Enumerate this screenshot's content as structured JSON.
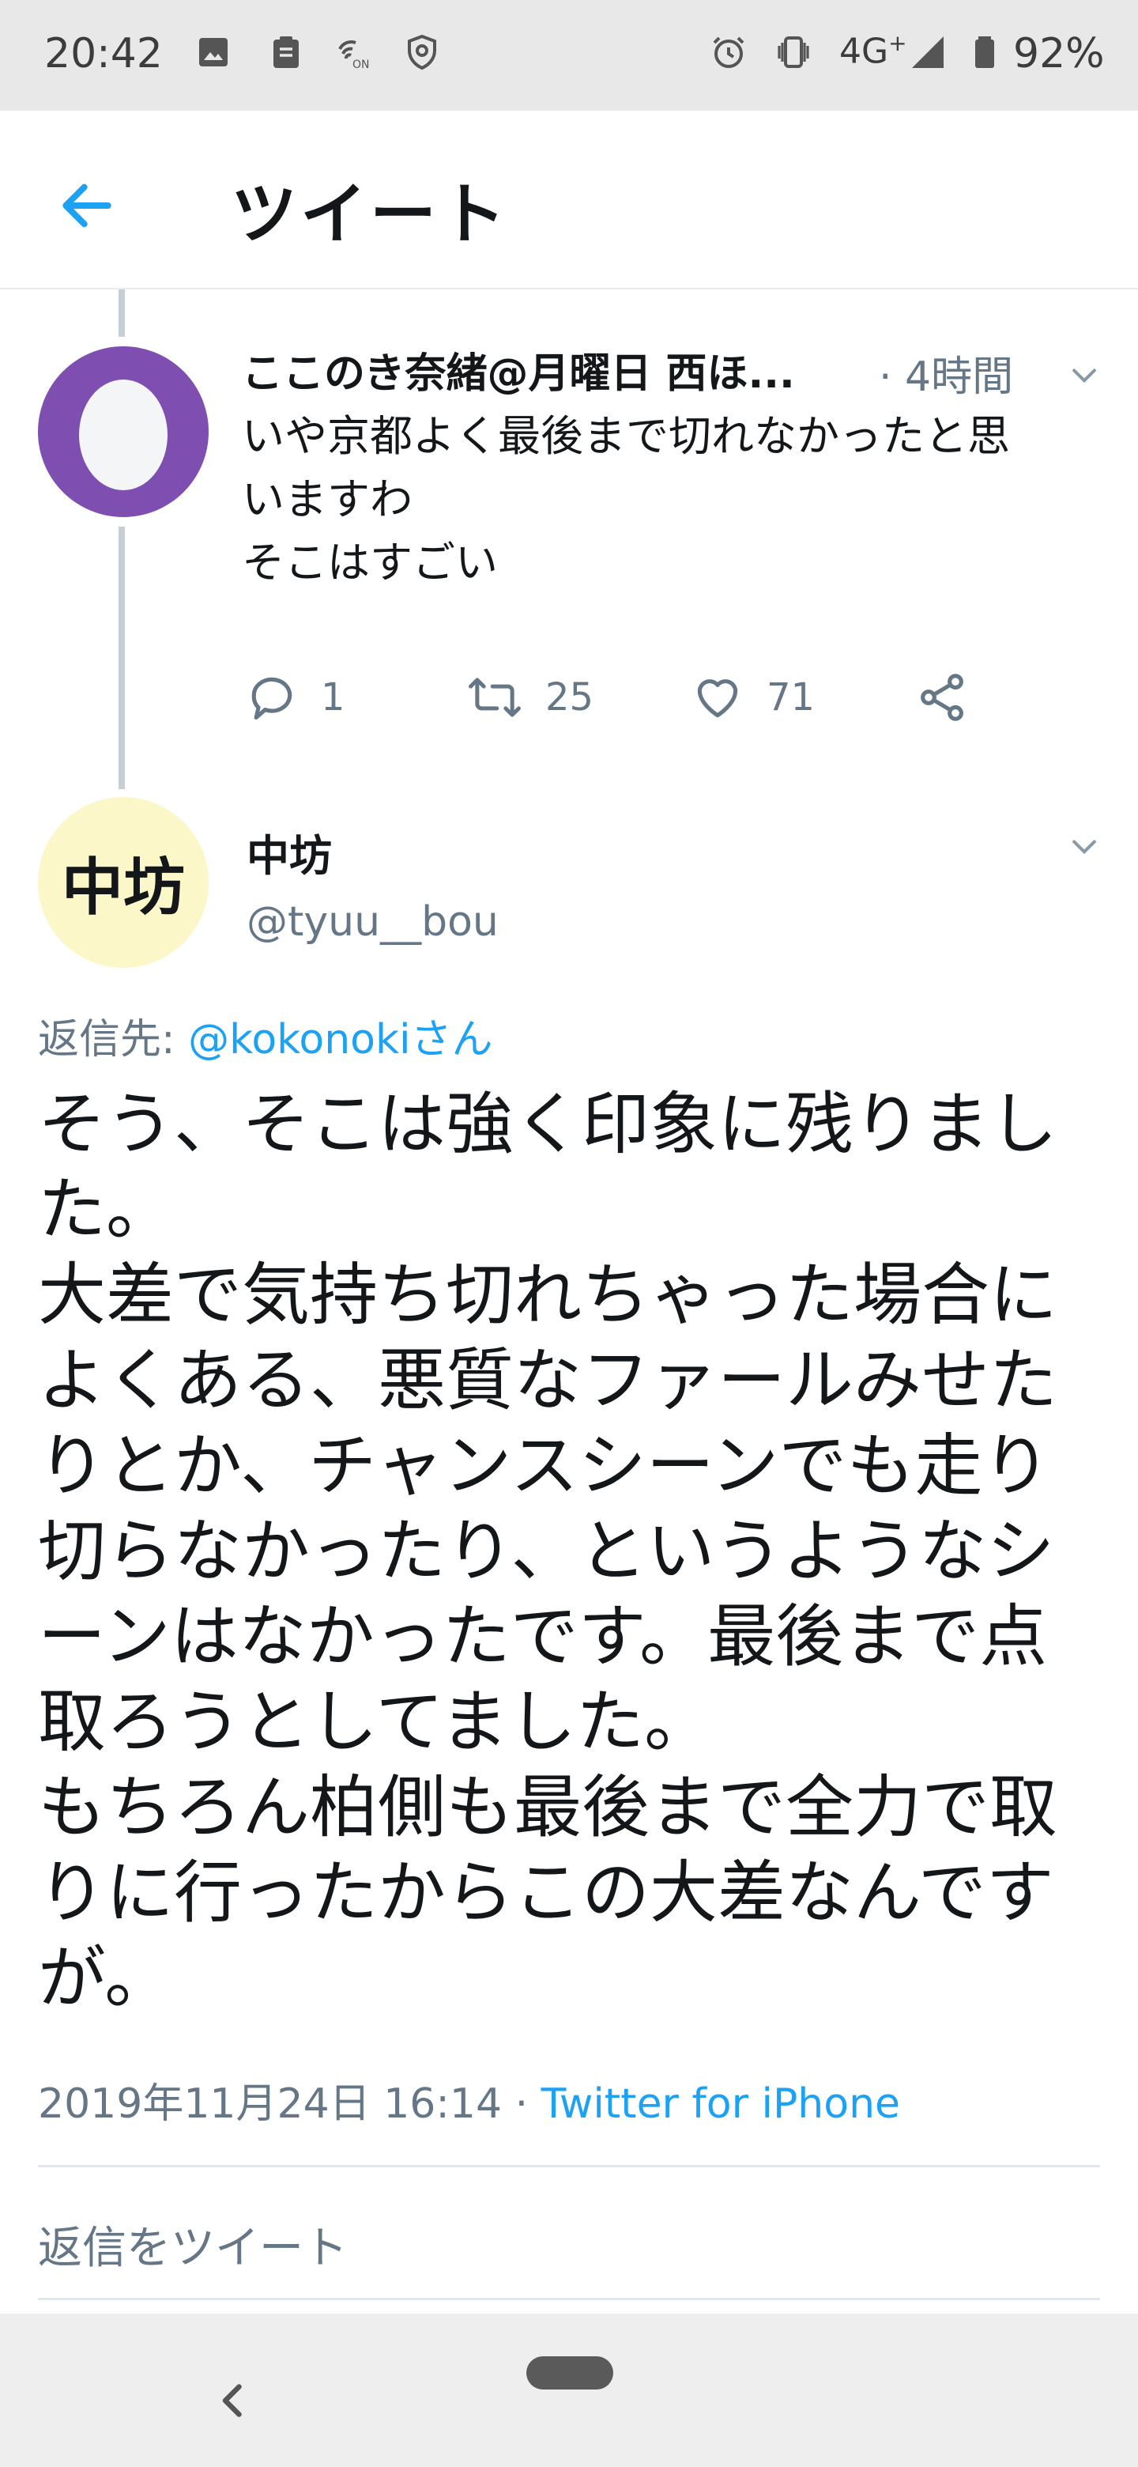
{
  "status_bar": {
    "time": "20:42",
    "network": "4G",
    "network_suffix": "+",
    "battery": "92%"
  },
  "header": {
    "title": "ツイート",
    "back_icon": "arrow-left-icon"
  },
  "parent_tweet": {
    "author_name": "ここのき奈緒@月曜日 西ほ...",
    "time": "· 4時間",
    "text_lines": [
      "いや京都よく最後まで切れなかったと思",
      "いますわ",
      "そこはすごい"
    ],
    "actions": {
      "reply_count": "1",
      "retweet_count": "25",
      "like_count": "71"
    }
  },
  "reply_tweet": {
    "avatar_text": "中坊",
    "author_name": "中坊",
    "handle": "@tyuu__bou",
    "reply_to_label": "返信先:",
    "reply_to_handle": "@kokonokiさん",
    "text_lines": [
      "そう、そこは強く印象に残りまし",
      "た。",
      "大差で気持ち切れちゃった場合に",
      "よくある、悪質なファールみせた",
      "りとか、チャンスシーンでも走り",
      "切らなかったり、というようなシ",
      "ーンはなかったです。最後まで点",
      "取ろうとしてました。",
      "もちろん柏側も最後まで全力で取",
      "りに行ったからこの大差なんです",
      "が。"
    ],
    "datetime": "2019年11月24日 16:14",
    "separator": " · ",
    "source": "Twitter for iPhone"
  },
  "reply_box": {
    "placeholder": "返信をツイート"
  },
  "colors": {
    "accent": "#1da1f2",
    "secondary_text": "#657786",
    "egg_avatar": "#7e4fb1",
    "reply_avatar": "#fbf7c8"
  }
}
